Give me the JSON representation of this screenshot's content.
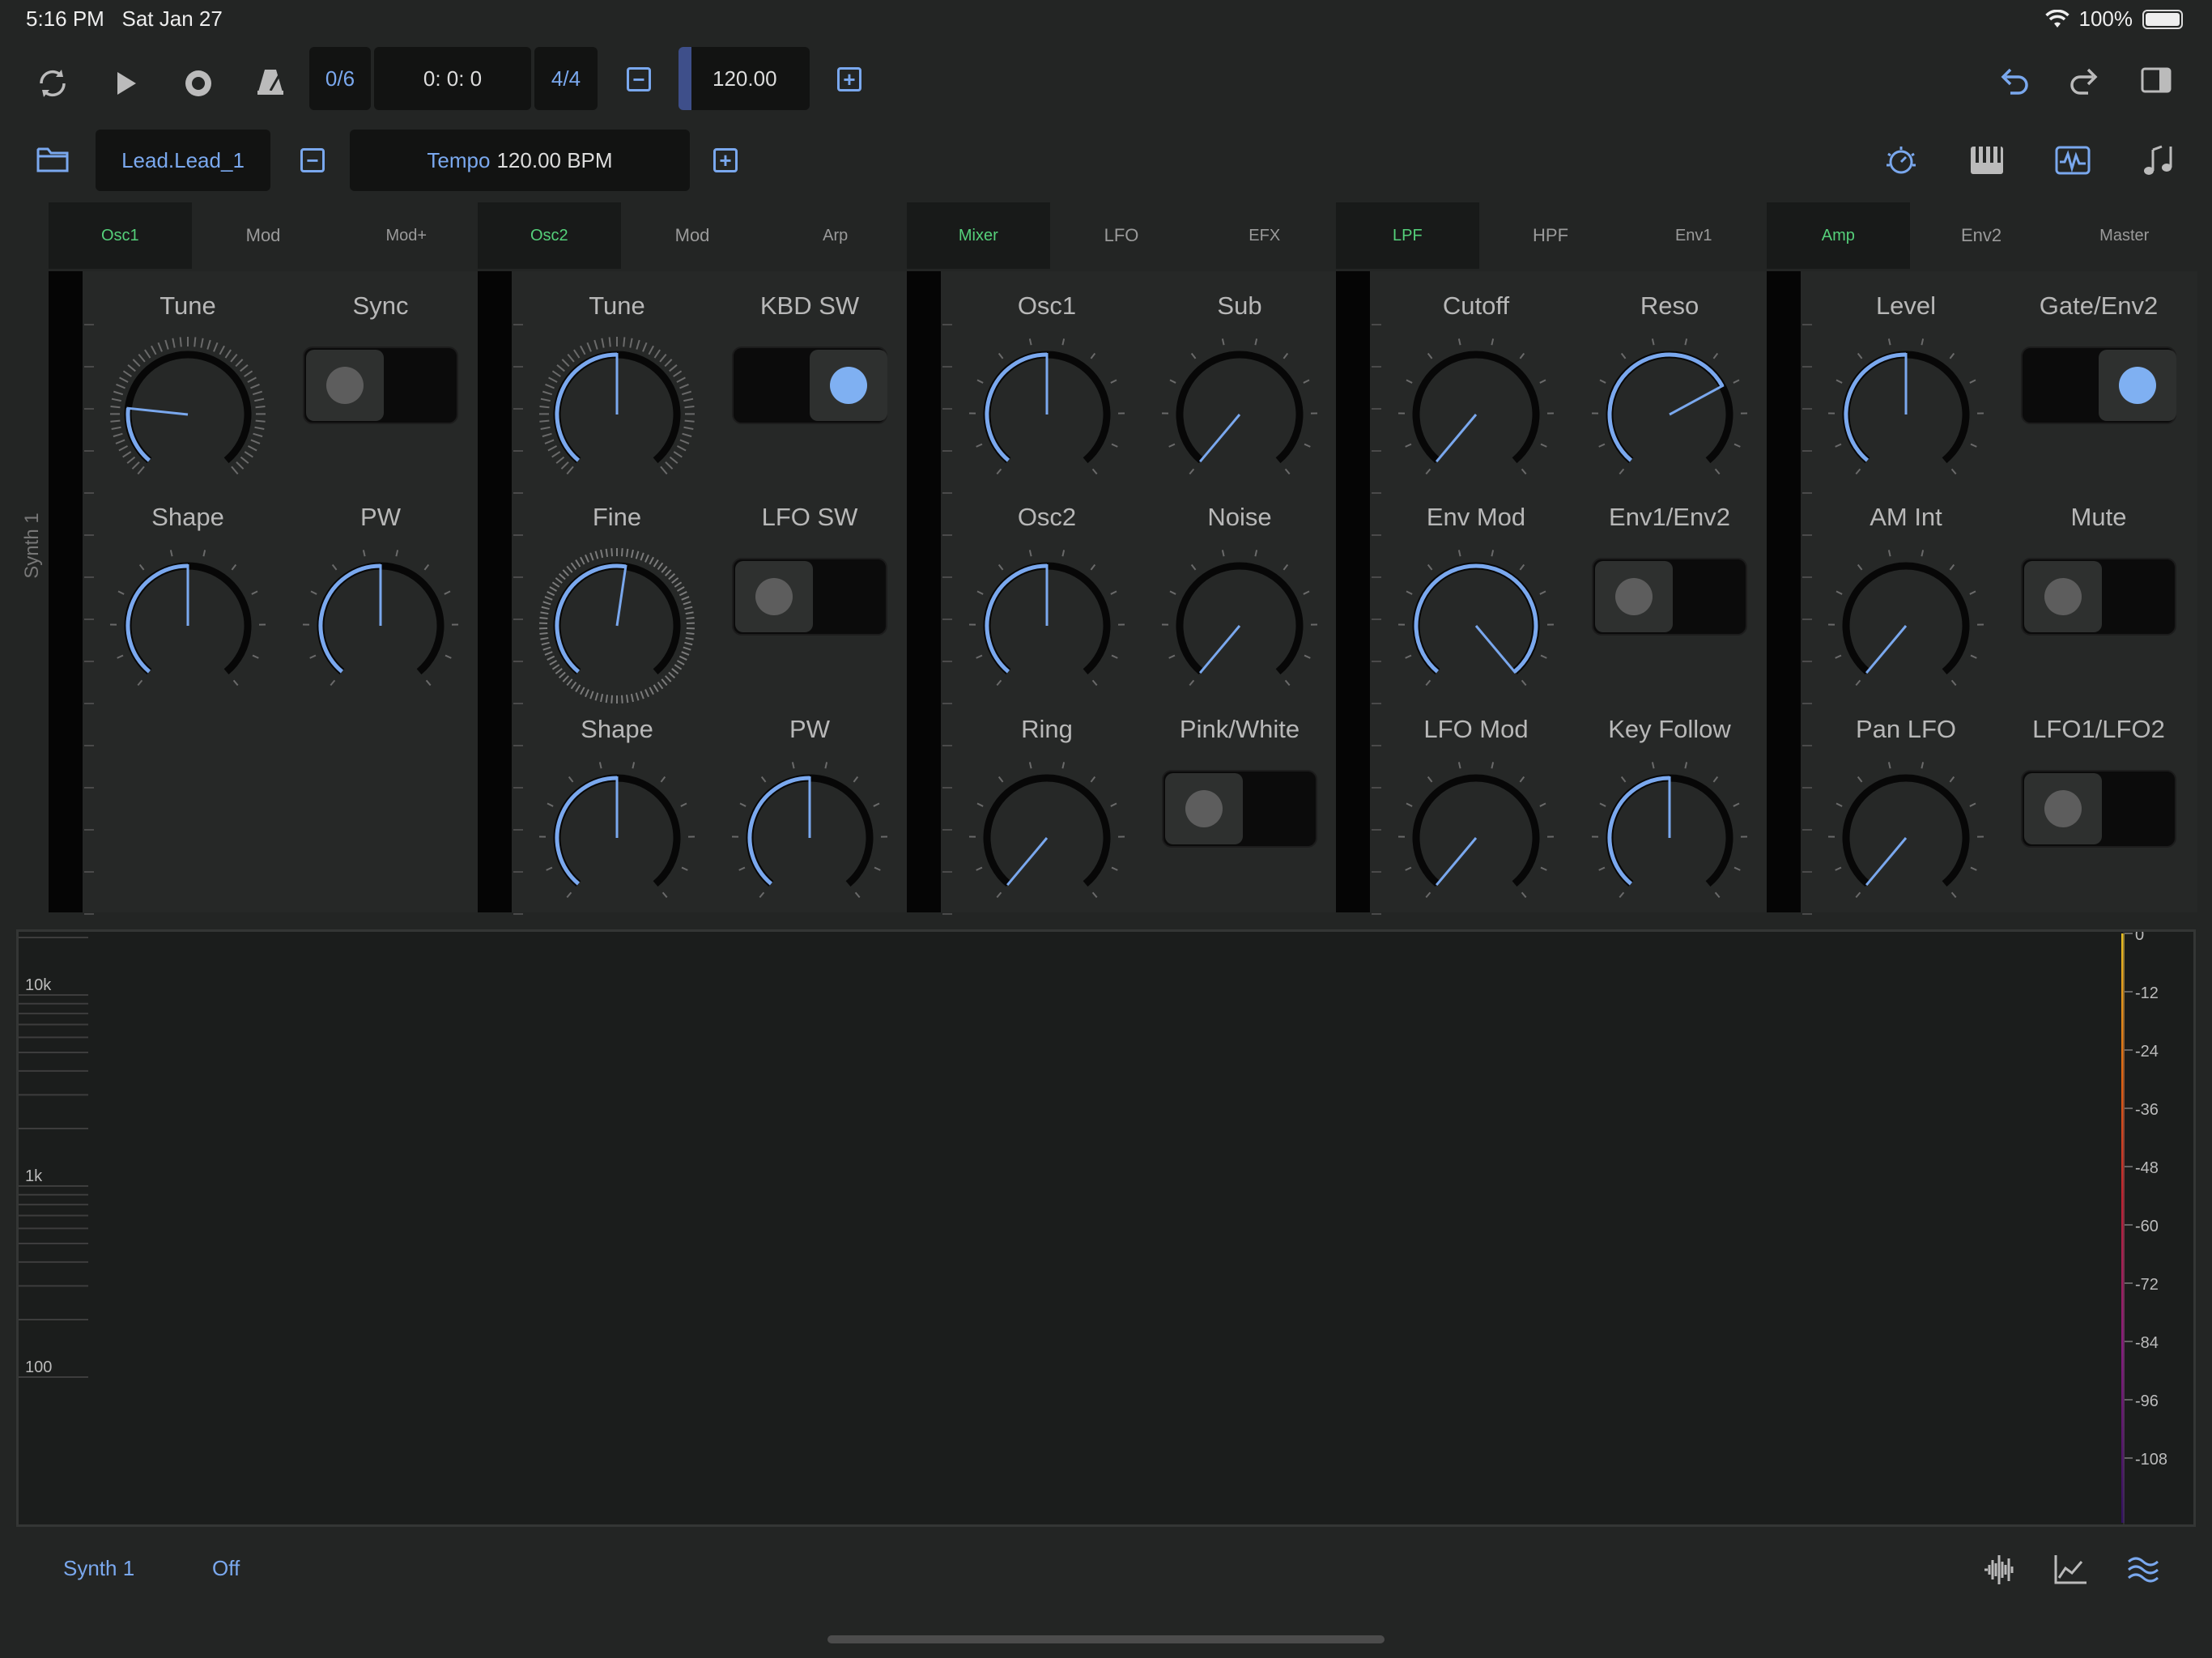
{
  "status_bar": {
    "time": "5:16 PM",
    "date": "Sat Jan 27",
    "battery": "100%"
  },
  "transport": {
    "pattern": "0/6",
    "position": "0: 0: 0",
    "meter": "4/4",
    "tempo_value": "120.00",
    "minus": "−",
    "plus": "+"
  },
  "preset_bar": {
    "preset_name": "Lead.Lead_1",
    "tempo_prefix": "Tempo",
    "tempo_value": "120.00 BPM"
  },
  "tabs": [
    {
      "label": "Osc1",
      "selected": true
    },
    {
      "label": "Mod",
      "selected": false
    },
    {
      "label": "Mod+",
      "selected": false
    },
    {
      "label": "Osc2",
      "selected": true
    },
    {
      "label": "Mod",
      "selected": false
    },
    {
      "label": "Arp",
      "selected": false
    },
    {
      "label": "Mixer",
      "selected": true
    },
    {
      "label": "LFO",
      "selected": false
    },
    {
      "label": "EFX",
      "selected": false
    },
    {
      "label": "LPF",
      "selected": true
    },
    {
      "label": "HPF",
      "selected": false
    },
    {
      "label": "Env1",
      "selected": false
    },
    {
      "label": "Amp",
      "selected": true
    },
    {
      "label": "Env2",
      "selected": false
    },
    {
      "label": "Master",
      "selected": false
    }
  ],
  "synth_label": "Synth 1",
  "controls": [
    {
      "label": "Tune",
      "type": "knob",
      "value": 0.2
    },
    {
      "label": "Sync",
      "type": "toggle",
      "on": false
    },
    {
      "label": "Shape",
      "type": "knob",
      "value": 0.5
    },
    {
      "label": "PW",
      "type": "knob",
      "value": 0.5
    },
    {
      "label": "Tune",
      "type": "knob",
      "value": 0.5
    },
    {
      "label": "KBD SW",
      "type": "toggle",
      "on": true
    },
    {
      "label": "Fine",
      "type": "knob",
      "value": 0.53
    },
    {
      "label": "LFO SW",
      "type": "toggle",
      "on": false
    },
    {
      "label": "Shape",
      "type": "knob",
      "value": 0.5
    },
    {
      "label": "PW",
      "type": "knob",
      "value": 0.5
    },
    {
      "label": "Osc1",
      "type": "knob",
      "value": 0.5
    },
    {
      "label": "Sub",
      "type": "knob",
      "value": 0.0
    },
    {
      "label": "Osc2",
      "type": "knob",
      "value": 0.5
    },
    {
      "label": "Noise",
      "type": "knob",
      "value": 0.0
    },
    {
      "label": "Ring",
      "type": "knob",
      "value": 0.0
    },
    {
      "label": "Pink/White",
      "type": "toggle",
      "on": false
    },
    {
      "label": "Cutoff",
      "type": "knob",
      "value": 0.0
    },
    {
      "label": "Reso",
      "type": "knob",
      "value": 0.72
    },
    {
      "label": "Env Mod",
      "type": "knob",
      "value": 1.0
    },
    {
      "label": "Env1/Env2",
      "type": "toggle",
      "on": false
    },
    {
      "label": "LFO Mod",
      "type": "knob",
      "value": 0.0
    },
    {
      "label": "Key Follow",
      "type": "knob",
      "value": 0.5
    },
    {
      "label": "Level",
      "type": "knob",
      "value": 0.5
    },
    {
      "label": "Gate/Env2",
      "type": "toggle",
      "on": true
    },
    {
      "label": "AM Int",
      "type": "knob",
      "value": 0.0
    },
    {
      "label": "Mute",
      "type": "toggle",
      "on": false
    },
    {
      "label": "Pan LFO",
      "type": "knob",
      "value": 0.0
    },
    {
      "label": "LFO1/LFO2",
      "type": "toggle",
      "on": false
    }
  ],
  "spectrum": {
    "freq_labels": [
      "10k",
      "1k",
      "100"
    ],
    "db_labels": [
      "0",
      "-12",
      "-24",
      "-36",
      "-48",
      "-60",
      "-72",
      "-84",
      "-96",
      "-108"
    ]
  },
  "bottom_bar": {
    "track": "Synth 1",
    "state": "Off"
  },
  "colors": {
    "accent": "#7aa8ee",
    "selected_tab": "#55d07a",
    "background": "#232524"
  }
}
